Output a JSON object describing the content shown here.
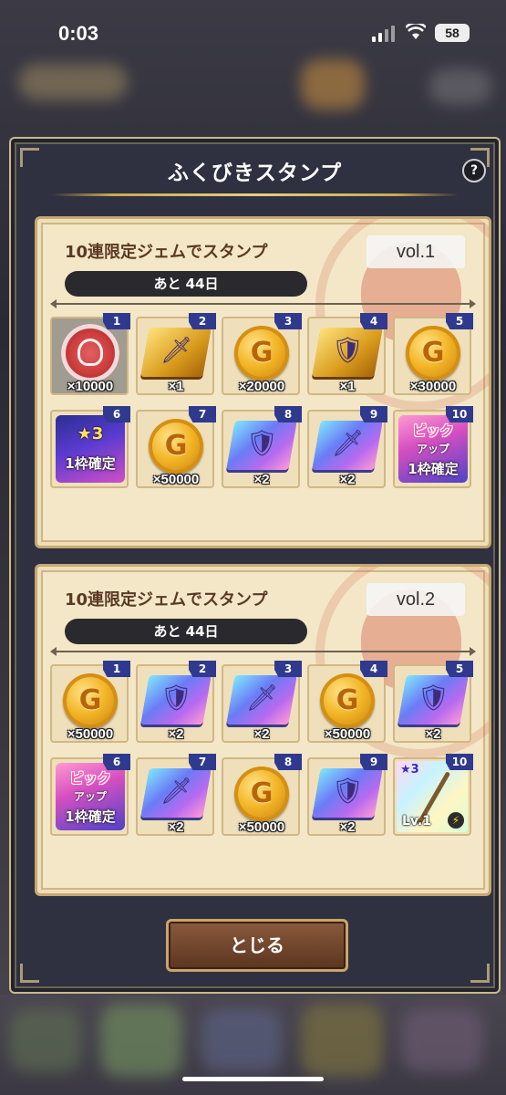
{
  "status": {
    "time": "0:03",
    "battery": "58"
  },
  "dialog": {
    "title": "ふくびきスタンプ",
    "help": "?",
    "close_label": "とじる"
  },
  "cards": [
    {
      "title": "10連限定ジェムでスタンプ",
      "vol": "vol.1",
      "remaining": "あと 44日",
      "slots": [
        {
          "n": "1",
          "type": "medal",
          "qty": "×10000",
          "done": true
        },
        {
          "n": "2",
          "type": "book-gold",
          "icon": "sword",
          "qty": "×1"
        },
        {
          "n": "3",
          "type": "coin",
          "qty": "×20000"
        },
        {
          "n": "4",
          "type": "book-gold",
          "icon": "shield",
          "qty": "×1"
        },
        {
          "n": "5",
          "type": "coin",
          "qty": "×30000"
        },
        {
          "n": "6",
          "type": "ticket-star",
          "line1": "★3",
          "line2": "1枠確定",
          "qty": ""
        },
        {
          "n": "7",
          "type": "coin",
          "qty": "×50000"
        },
        {
          "n": "8",
          "type": "book",
          "icon": "shield",
          "qty": "×2"
        },
        {
          "n": "9",
          "type": "book",
          "icon": "sword",
          "qty": "×2"
        },
        {
          "n": "10",
          "type": "ticket-pickup",
          "line1": "ピック",
          "line3": "アップ",
          "line2": "1枠確定",
          "qty": ""
        }
      ]
    },
    {
      "title": "10連限定ジェムでスタンプ",
      "vol": "vol.2",
      "remaining": "あと 44日",
      "slots": [
        {
          "n": "1",
          "type": "coin",
          "qty": "×50000"
        },
        {
          "n": "2",
          "type": "book",
          "icon": "shield",
          "qty": "×2"
        },
        {
          "n": "3",
          "type": "book",
          "icon": "sword",
          "qty": "×2"
        },
        {
          "n": "4",
          "type": "coin",
          "qty": "×50000"
        },
        {
          "n": "5",
          "type": "book",
          "icon": "shield",
          "qty": "×2"
        },
        {
          "n": "6",
          "type": "ticket-pickup",
          "line1": "ピック",
          "line3": "アップ",
          "line2": "1枠確定",
          "qty": ""
        },
        {
          "n": "7",
          "type": "book",
          "icon": "sword",
          "qty": "×2"
        },
        {
          "n": "8",
          "type": "coin",
          "qty": "×50000"
        },
        {
          "n": "9",
          "type": "book",
          "icon": "shield",
          "qty": "×2"
        },
        {
          "n": "10",
          "type": "weapon",
          "star": "★3",
          "lv": "Lv.1",
          "qty": ""
        }
      ]
    }
  ],
  "colors": {
    "accent_number_tab": "#2f3a8e",
    "coin_gold": "#f2b526",
    "card_bg": "#f3e7c7",
    "dialog_bg": "#2f3040"
  }
}
